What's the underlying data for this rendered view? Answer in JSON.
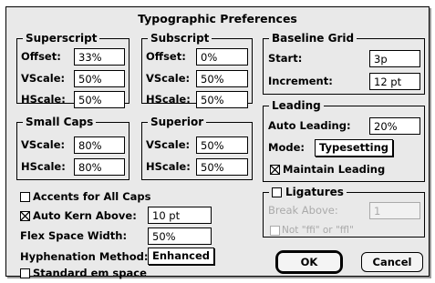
{
  "dialog": {
    "title": "Typographic Preferences"
  },
  "superscript": {
    "label": "Superscript",
    "offset_label": "Offset:",
    "offset": "33%",
    "vscale_label": "VScale:",
    "vscale": "50%",
    "hscale_label": "HScale:",
    "hscale": "50%"
  },
  "subscript": {
    "label": "Subscript",
    "offset_label": "Offset:",
    "offset": "0%",
    "vscale_label": "VScale:",
    "vscale": "50%",
    "hscale_label": "HScale:",
    "hscale": "50%"
  },
  "small_caps": {
    "label": "Small Caps",
    "vscale_label": "VScale:",
    "vscale": "80%",
    "hscale_label": "HScale:",
    "hscale": "80%"
  },
  "superior": {
    "label": "Superior",
    "vscale_label": "VScale:",
    "vscale": "50%",
    "hscale_label": "HScale:",
    "hscale": "50%"
  },
  "baseline_grid": {
    "label": "Baseline Grid",
    "start_label": "Start:",
    "start": "3p",
    "increment_label": "Increment:",
    "increment": "12 pt"
  },
  "leading": {
    "label": "Leading",
    "auto_label": "Auto Leading:",
    "auto": "20%",
    "mode_label": "Mode:",
    "mode": "Typesetting",
    "maintain_label": "Maintain Leading",
    "maintain_checked": true
  },
  "ligatures": {
    "label": "Ligatures",
    "checked": false,
    "break_label": "Break Above:",
    "break_value": "1",
    "not_label": "Not \"ffi\" or \"ffl\"",
    "not_checked": false
  },
  "options": {
    "accents_label": "Accents for All Caps",
    "accents_checked": false,
    "kern_label": "Auto Kern Above:",
    "kern_checked": true,
    "kern_value": "10 pt",
    "flex_label": "Flex Space Width:",
    "flex_value": "50%",
    "hyphen_label": "Hyphenation Method:",
    "hyphen_value": "Enhanced",
    "em_label": "Standard em space",
    "em_checked": false
  },
  "buttons": {
    "ok": "OK",
    "cancel": "Cancel"
  }
}
